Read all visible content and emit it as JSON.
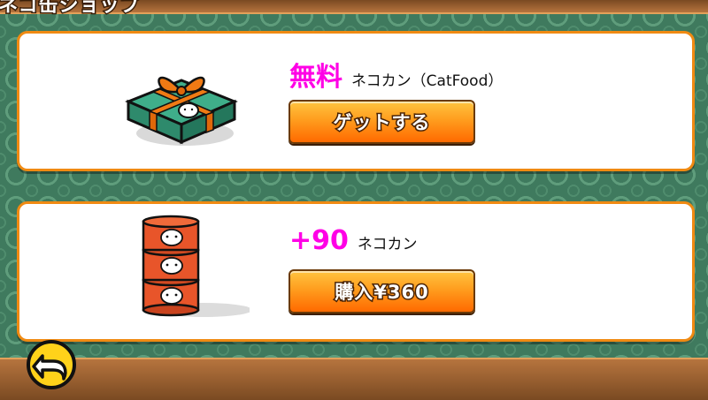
{
  "header": {
    "title_partial": "ネコ缶ショップ"
  },
  "shop_items": [
    {
      "price_highlight": "無料",
      "item_name": "ネコカン（CatFood）",
      "button_label": "ゲットする",
      "icon": "gift-box-icon"
    },
    {
      "price_highlight": "+90",
      "item_name": "ネコカン",
      "button_label": "購入¥360",
      "icon": "cat-food-cans-icon"
    }
  ],
  "footer": {
    "back_icon": "back-arrow-icon"
  },
  "colors": {
    "panel_border": "#f08a12",
    "price_highlight": "#ff00e6",
    "button_orange": "#ff9d1e",
    "background_green": "#3f7a5e"
  }
}
